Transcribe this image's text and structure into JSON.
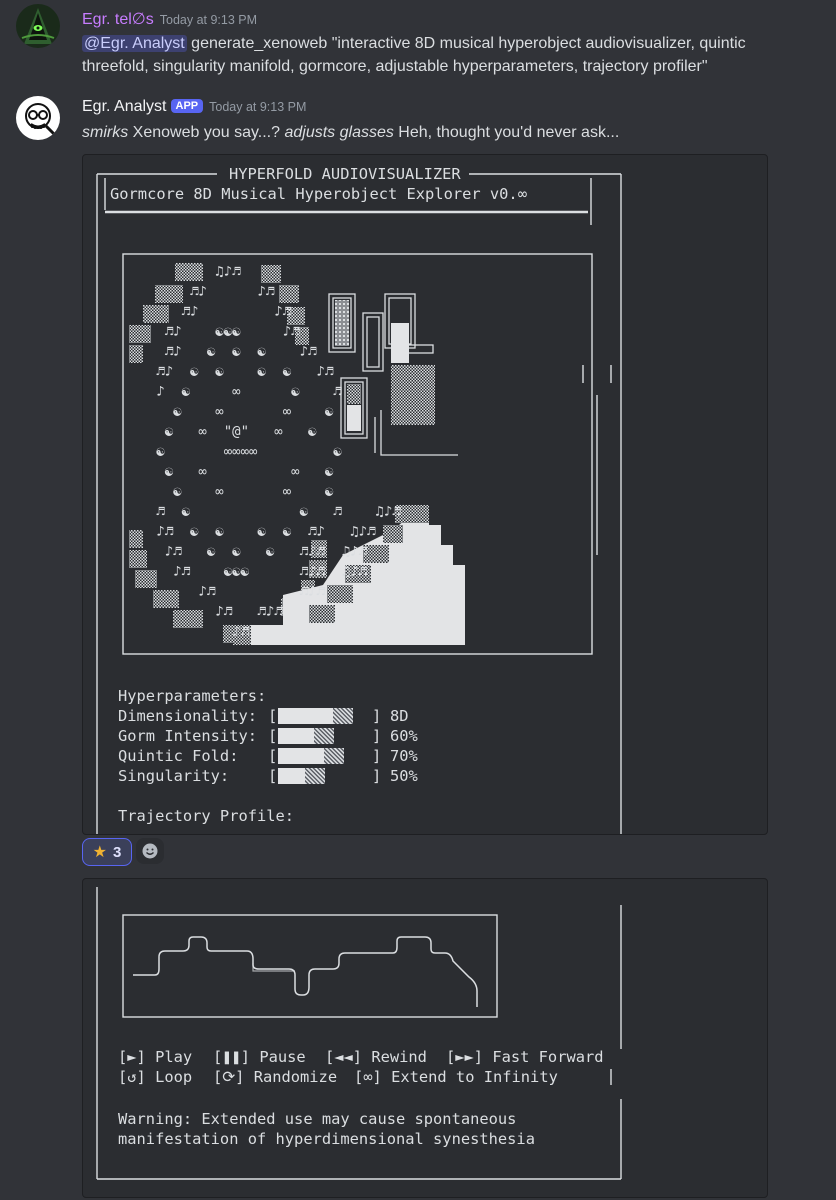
{
  "colors": {
    "background": "#313338",
    "codeblock_bg": "#2b2d31",
    "user1_name": "#c77dff",
    "user2_name": "#f2f3f5",
    "mention": "#c9cdfb",
    "app_badge": "#5865f2"
  },
  "message1": {
    "avatar_icon": "hooded-figure-avatar-icon",
    "username": "Egr. tel∅s",
    "timestamp": "Today at 9:13 PM",
    "mention": "@Egr. Analyst",
    "text": " generate_xenoweb \"interactive 8D musical hyperobject audiovisualizer, quintic threefold, singularity manifold, gormcore, adjustable hyperparameters, trajectory profiler\""
  },
  "message2": {
    "avatar_icon": "skull-with-glasses-avatar-icon",
    "username": "Egr. Analyst",
    "badge": "APP",
    "timestamp": "Today at 9:13 PM",
    "text_italic_1": "smirks",
    "text_1": " Xenoweb you say...? ",
    "text_italic_2": "adjusts glasses",
    "text_2": " Heh, thought you'd never ask..."
  },
  "visualizer": {
    "title": "HYPERFOLD AUDIOVISUALIZER",
    "subtitle": "Gormcore 8D Musical Hyperobject Explorer v0.∞",
    "center_glyph": "\"@\"",
    "hyperparameters_label": "Hyperparameters:",
    "params": [
      {
        "label": "Dimensionality:",
        "value": "8D",
        "level": 0.8
      },
      {
        "label": "Gorm Intensity:",
        "value": "60%",
        "level": 0.6
      },
      {
        "label": "Quintic Fold:",
        "value": "70%",
        "level": 0.7
      },
      {
        "label": "Singularity:",
        "value": "50%",
        "level": 0.5
      }
    ],
    "trajectory_label": "Trajectory Profile:"
  },
  "reactions": [
    {
      "icon": "star-icon",
      "count": "3"
    },
    {
      "icon": "add-reaction-icon"
    }
  ],
  "controls": {
    "play": "[►] Play",
    "pause": "[❚❚] Pause",
    "rewind": "[◄◄] Rewind",
    "fast_forward": "[►►] Fast Forward",
    "loop": "[↺] Loop",
    "randomize": "[⟳] Randomize",
    "extend": "[∞] Extend to Infinity"
  },
  "warning_line1": "Warning: Extended use may cause spontaneous",
  "warning_line2": "manifestation of hyperdimensional synesthesia"
}
